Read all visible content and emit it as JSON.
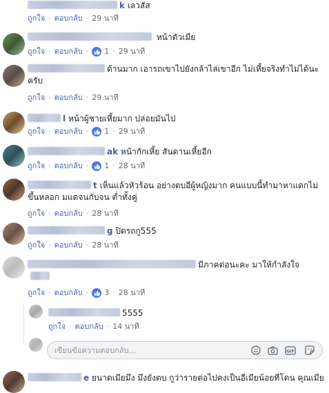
{
  "actions": {
    "like": "ถูกใจ",
    "reply": "ตอบกลับ"
  },
  "comments": [
    {
      "name_tail": "k",
      "text": "เลวสัส",
      "likes": "",
      "time": "29 นาที"
    },
    {
      "name_tail": "",
      "text": "หน้าตัวเมีย",
      "likes": "1",
      "time": "29 นาที"
    },
    {
      "name_tail": "",
      "text": "ด้านมาก เอารถเขาไปยังกล้าไล่เขาอีก ไม่เหี้ยจริงทำไม่ได้นะครับ",
      "likes": "",
      "time": "29 นาที"
    },
    {
      "name_tail": "l",
      "text": "หน้าผู้ชายเหี้ยมาก ปล่อยมันไป",
      "likes": "1",
      "time": "29 นาที"
    },
    {
      "name_tail": "ak",
      "text": "หน้ากักเหี้ย สันดานเหี้ยอีก",
      "likes": "1",
      "time": "28 นาที"
    },
    {
      "name_tail": "t",
      "text": "เห็นแล้วหัวร้อน อย่างตบอีผู้หญิงมาก คนแบบนี้ทำมาหาแดกไม่ขึ้นหลอก มแดจนกับจน ต่ำทั้งคู่",
      "likes": "",
      "time": "28 นาที"
    },
    {
      "name_tail": "g",
      "text": "ปิดรถกู555",
      "likes": "",
      "time": "28 นาที"
    },
    {
      "name_tail": "",
      "text": "มีภาคต่อนะคะ มาให้กำลังใจ",
      "likes": "3",
      "time": "28 นาที"
    }
  ],
  "reply": {
    "name_tail": "",
    "text": "5555",
    "time": "14 นาที"
  },
  "composer": {
    "placeholder": "เขียนข้อความตอบกลับ..."
  },
  "last_comment": {
    "name_tail": "e",
    "text": "ยนาดเมียมึง มึงยังตบ กูว่ารายต่อไปคงเป็นอีเมียน้อยที่โดน คุณเมีย"
  }
}
